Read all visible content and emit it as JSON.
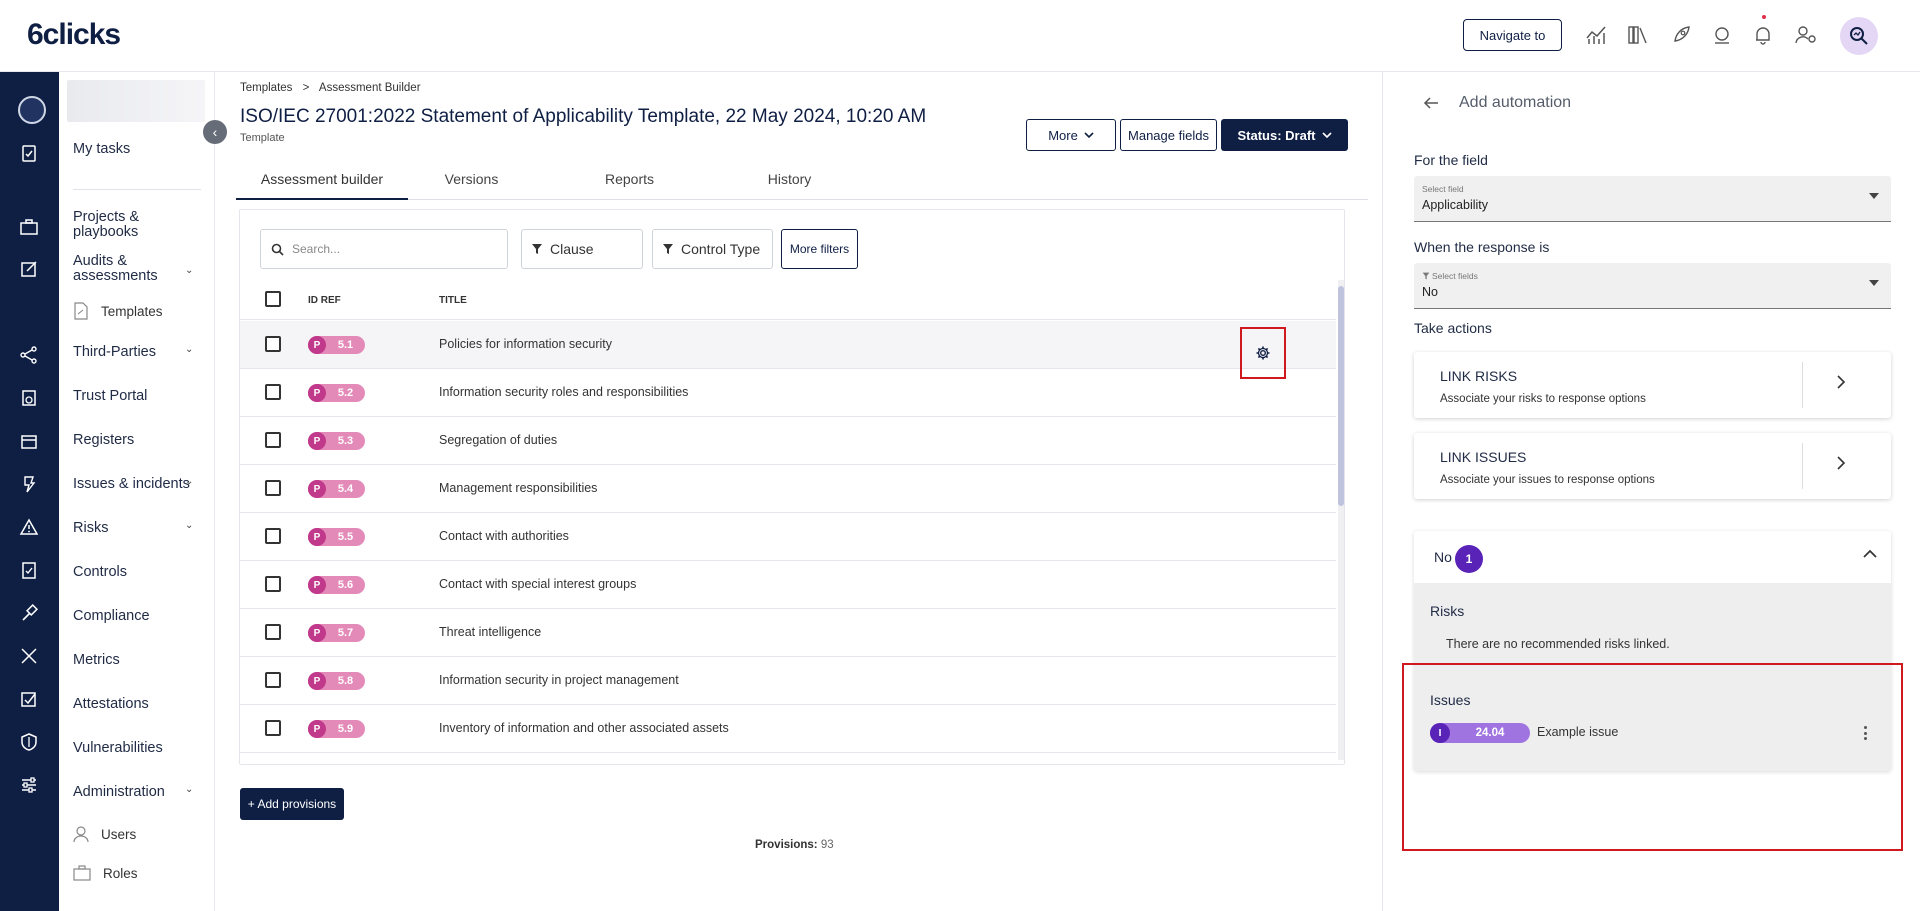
{
  "app": {
    "logo": "6clicks"
  },
  "header": {
    "navigate_label": "Navigate to"
  },
  "sidebar": {
    "items": [
      {
        "label": "My tasks"
      },
      {
        "label": "Projects & playbooks"
      },
      {
        "label": "Audits & assessments"
      },
      {
        "label": "Templates"
      },
      {
        "label": "Third-Parties"
      },
      {
        "label": "Trust Portal"
      },
      {
        "label": "Registers"
      },
      {
        "label": "Issues & incidents"
      },
      {
        "label": "Risks"
      },
      {
        "label": "Controls"
      },
      {
        "label": "Compliance"
      },
      {
        "label": "Metrics"
      },
      {
        "label": "Attestations"
      },
      {
        "label": "Vulnerabilities"
      },
      {
        "label": "Administration"
      },
      {
        "label": "Users"
      },
      {
        "label": "Roles"
      }
    ]
  },
  "main": {
    "breadcrumb": {
      "parent": "Templates",
      "separator": ">",
      "current": "Assessment Builder"
    },
    "title": "ISO/IEC 27001:2022 Statement of Applicability Template, 22 May 2024, 10:20 AM",
    "subtitle": "Template",
    "actions": {
      "more": "More",
      "manage_fields": "Manage fields",
      "status": "Status: Draft"
    },
    "tabs": [
      {
        "label": "Assessment builder",
        "active": true
      },
      {
        "label": "Versions"
      },
      {
        "label": "Reports"
      },
      {
        "label": "History"
      }
    ],
    "search_placeholder": "Search...",
    "filters": {
      "clause": "Clause",
      "control_type": "Control Type",
      "more": "More filters"
    },
    "columns": {
      "id_ref": "ID REF",
      "title": "TITLE"
    },
    "rows": [
      {
        "prefix": "P",
        "id": "5.1",
        "title": "Policies for information security"
      },
      {
        "prefix": "P",
        "id": "5.2",
        "title": "Information security roles and responsibilities"
      },
      {
        "prefix": "P",
        "id": "5.3",
        "title": "Segregation of duties"
      },
      {
        "prefix": "P",
        "id": "5.4",
        "title": "Management responsibilities"
      },
      {
        "prefix": "P",
        "id": "5.5",
        "title": "Contact with authorities"
      },
      {
        "prefix": "P",
        "id": "5.6",
        "title": "Contact with special interest groups"
      },
      {
        "prefix": "P",
        "id": "5.7",
        "title": "Threat intelligence"
      },
      {
        "prefix": "P",
        "id": "5.8",
        "title": "Information security in project management"
      },
      {
        "prefix": "P",
        "id": "5.9",
        "title": "Inventory of information and other associated assets"
      }
    ],
    "add_provisions": "+ Add provisions",
    "provisions": {
      "label": "Provisions:",
      "value": "93"
    }
  },
  "panel": {
    "title": "Add automation",
    "for_field": {
      "label": "For the field",
      "select_label": "Select field",
      "value": "Applicability"
    },
    "response": {
      "label": "When the response is",
      "select_label": "Select fields",
      "value": "No"
    },
    "take_actions": "Take actions",
    "actions": [
      {
        "title": "LINK RISKS",
        "desc": "Associate your risks to response options"
      },
      {
        "title": "LINK ISSUES",
        "desc": "Associate your issues to response options"
      }
    ],
    "accordion": {
      "label": "No",
      "count": "1",
      "risks_title": "Risks",
      "risks_empty": "There are no recommended risks linked.",
      "issues_title": "Issues",
      "issue": {
        "prefix": "I",
        "id": "24.04",
        "name": "Example issue"
      }
    }
  },
  "colors": {
    "navy": "#0f1f44",
    "pill_pink": "#e38ab8",
    "pill_dark": "#c0398a",
    "purple": "#5a23b8",
    "highlight_red": "#d0191f"
  }
}
